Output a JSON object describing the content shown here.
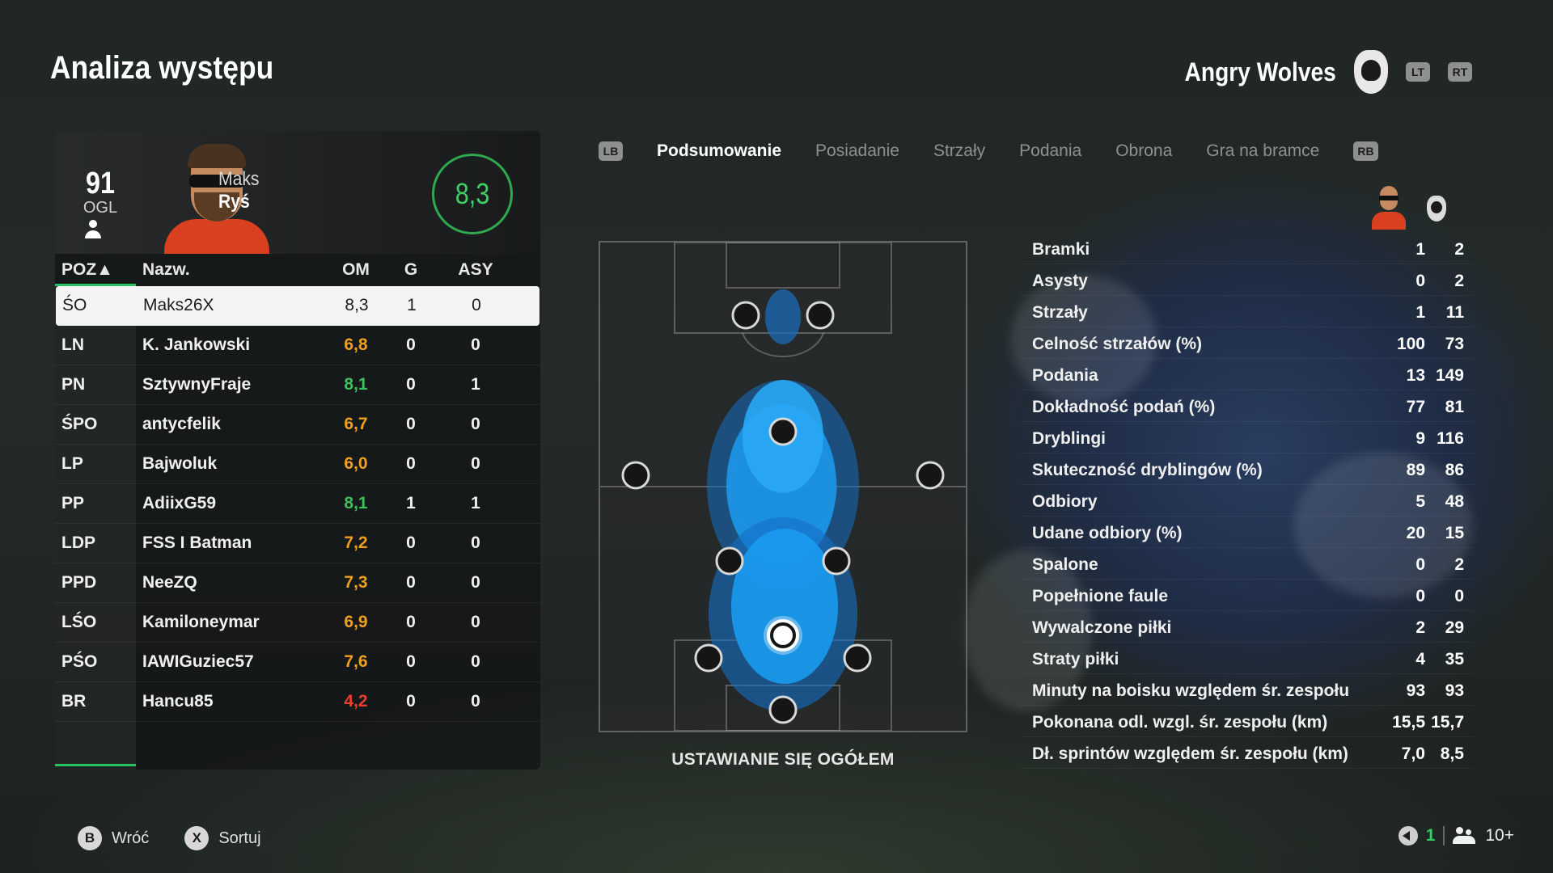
{
  "page": {
    "title": "Analiza występu"
  },
  "team": {
    "name": "Angry Wolves",
    "lt_label": "LT",
    "rt_label": "RT"
  },
  "player": {
    "overall": "91",
    "overall_label": "OGL",
    "first_name": "Maks",
    "last_name": "Ryś",
    "match_rating": "8,3"
  },
  "table": {
    "headers": {
      "pos": "POZ▲",
      "name": "Nazw.",
      "om": "OM",
      "g": "G",
      "asy": "ASY"
    },
    "rows": [
      {
        "pos": "ŚO",
        "name": "Maks26X",
        "om": "8,3",
        "om_color": "#1c1c1c",
        "g": "1",
        "asy": "0"
      },
      {
        "pos": "LN",
        "name": "K. Jankowski",
        "om": "6,8",
        "om_color": "#f0a020",
        "g": "0",
        "asy": "0"
      },
      {
        "pos": "PN",
        "name": "SztywnyFraje",
        "om": "8,1",
        "om_color": "#3fbf5a",
        "g": "0",
        "asy": "1"
      },
      {
        "pos": "ŚPO",
        "name": "antycfelik",
        "om": "6,7",
        "om_color": "#f0a020",
        "g": "0",
        "asy": "0"
      },
      {
        "pos": "LP",
        "name": "Bajwoluk",
        "om": "6,0",
        "om_color": "#f0a020",
        "g": "0",
        "asy": "0"
      },
      {
        "pos": "PP",
        "name": "AdiixG59",
        "om": "8,1",
        "om_color": "#3fbf5a",
        "g": "1",
        "asy": "1"
      },
      {
        "pos": "LDP",
        "name": "FSS I Batman",
        "om": "7,2",
        "om_color": "#f0a020",
        "g": "0",
        "asy": "0"
      },
      {
        "pos": "PPD",
        "name": "NeeZQ",
        "om": "7,3",
        "om_color": "#f0a020",
        "g": "0",
        "asy": "0"
      },
      {
        "pos": "LŚO",
        "name": "Kamiloneymar",
        "om": "6,9",
        "om_color": "#f0a020",
        "g": "0",
        "asy": "0"
      },
      {
        "pos": "PŚO",
        "name": "IAWIGuziec57",
        "om": "7,6",
        "om_color": "#f0a020",
        "g": "0",
        "asy": "0"
      },
      {
        "pos": "BR",
        "name": "Hancu85",
        "om": "4,2",
        "om_color": "#e8402a",
        "g": "0",
        "asy": "0"
      }
    ]
  },
  "tabs": {
    "lb": "LB",
    "rb": "RB",
    "items": [
      "Podsumowanie",
      "Posiadanie",
      "Strzały",
      "Podania",
      "Obrona",
      "Gra na bramce"
    ],
    "active": 0
  },
  "pitch": {
    "label": "USTAWIANIE SIĘ OGÓŁEM",
    "heat_color": "#1a9bf0"
  },
  "stats": [
    {
      "label": "Bramki",
      "player": "1",
      "team": "2"
    },
    {
      "label": "Asysty",
      "player": "0",
      "team": "2"
    },
    {
      "label": "Strzały",
      "player": "1",
      "team": "11"
    },
    {
      "label": "Celność strzałów (%)",
      "player": "100",
      "team": "73"
    },
    {
      "label": "Podania",
      "player": "13",
      "team": "149"
    },
    {
      "label": "Dokładność podań (%)",
      "player": "77",
      "team": "81"
    },
    {
      "label": "Dryblingi",
      "player": "9",
      "team": "116"
    },
    {
      "label": "Skuteczność dryblingów (%)",
      "player": "89",
      "team": "86"
    },
    {
      "label": "Odbiory",
      "player": "5",
      "team": "48"
    },
    {
      "label": "Udane odbiory (%)",
      "player": "20",
      "team": "15"
    },
    {
      "label": "Spalone",
      "player": "0",
      "team": "2"
    },
    {
      "label": "Popełnione faule",
      "player": "0",
      "team": "0"
    },
    {
      "label": "Wywalczone piłki",
      "player": "2",
      "team": "29"
    },
    {
      "label": "Straty piłki",
      "player": "4",
      "team": "35"
    },
    {
      "label": "Minuty na boisku względem śr. zespołu",
      "player": "93",
      "team": "93"
    },
    {
      "label": "Pokonana odl. wzgl. śr. zespołu (km)",
      "player": "15,5",
      "team": "15,7"
    },
    {
      "label": "Dł. sprintów względem śr. zespołu (km)",
      "player": "7,0",
      "team": "8,5"
    }
  ],
  "footer": {
    "back_key": "B",
    "back_label": "Wróć",
    "sort_key": "X",
    "sort_label": "Sortuj",
    "count": "1",
    "party": "10+"
  },
  "colors": {
    "accent_green": "#27c264",
    "rating_ring": "#2fa84f"
  }
}
